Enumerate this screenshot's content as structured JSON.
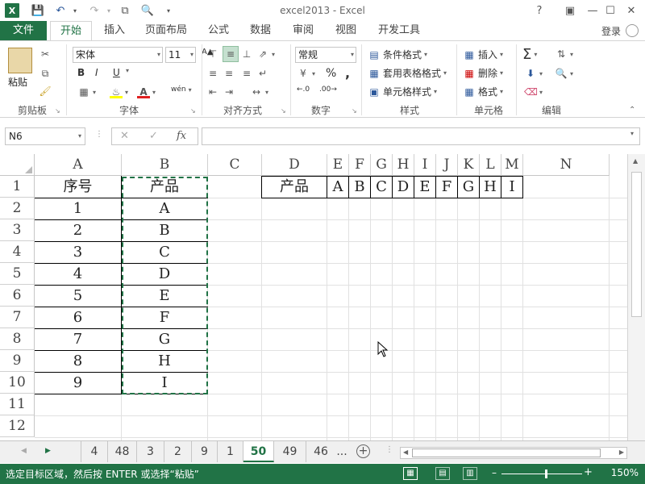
{
  "app": {
    "title": "excel2013 - Excel",
    "logo": "X",
    "login": "登录"
  },
  "titlebar_icons": [
    "save-icon",
    "undo-icon",
    "redo-icon",
    "copy-icon",
    "print-preview-icon",
    "help-icon",
    "ribbon-options-icon",
    "minimize-icon",
    "maximize-icon",
    "close-icon"
  ],
  "tabs": [
    {
      "label": "文件"
    },
    {
      "label": "开始"
    },
    {
      "label": "插入"
    },
    {
      "label": "页面布局"
    },
    {
      "label": "公式"
    },
    {
      "label": "数据"
    },
    {
      "label": "审阅"
    },
    {
      "label": "视图"
    },
    {
      "label": "开发工具"
    }
  ],
  "ribbon": {
    "clipboard": {
      "paste": "粘贴",
      "label": "剪贴板"
    },
    "font": {
      "name": "宋体",
      "size": "11",
      "bold": "B",
      "italic": "I",
      "underline": "U",
      "label": "字体",
      "phonetic": "wén"
    },
    "alignment": {
      "label": "对齐方式"
    },
    "number": {
      "format": "常规",
      "percent": "%",
      "comma": ",",
      "label": "数字"
    },
    "styles": {
      "conditional": "条件格式",
      "table": "套用表格格式",
      "cell_styles": "单元格样式",
      "label": "样式"
    },
    "cells": {
      "insert": "插入",
      "delete": "删除",
      "format": "格式",
      "label": "单元格"
    },
    "editing": {
      "label": "编辑"
    }
  },
  "formula_bar": {
    "name_box": "N6",
    "fx": "fx",
    "formula": ""
  },
  "columns": [
    "A",
    "B",
    "C",
    "D",
    "E",
    "F",
    "G",
    "H",
    "I",
    "J",
    "K",
    "L",
    "M",
    "N"
  ],
  "rows": [
    "1",
    "2",
    "3",
    "4",
    "5",
    "6",
    "7",
    "8",
    "9",
    "10",
    "11",
    "12"
  ],
  "cells": {
    "A1": "序号",
    "B1": "产品",
    "A2": "1",
    "B2": "A",
    "A3": "2",
    "B3": "B",
    "A4": "3",
    "B4": "C",
    "A5": "4",
    "B5": "D",
    "A6": "5",
    "B6": "E",
    "A7": "6",
    "B7": "F",
    "A8": "7",
    "B8": "G",
    "A9": "8",
    "B9": "H",
    "A10": "9",
    "B10": "I",
    "D1": "产品",
    "E1": "A",
    "F1": "B",
    "G1": "C",
    "H1": "D",
    "I1": "E",
    "J1": "F",
    "K1": "G",
    "L1": "H",
    "M1": "I"
  },
  "sheets": [
    "4",
    "48",
    "3",
    "2",
    "9",
    "1",
    "50",
    "49",
    "46",
    "..."
  ],
  "active_sheet": "50",
  "status": {
    "text": "选定目标区域，然后按 ENTER 或选择“粘贴”",
    "zoom": "150%"
  },
  "colors": {
    "accent": "#217346",
    "marquee": "#217346"
  }
}
